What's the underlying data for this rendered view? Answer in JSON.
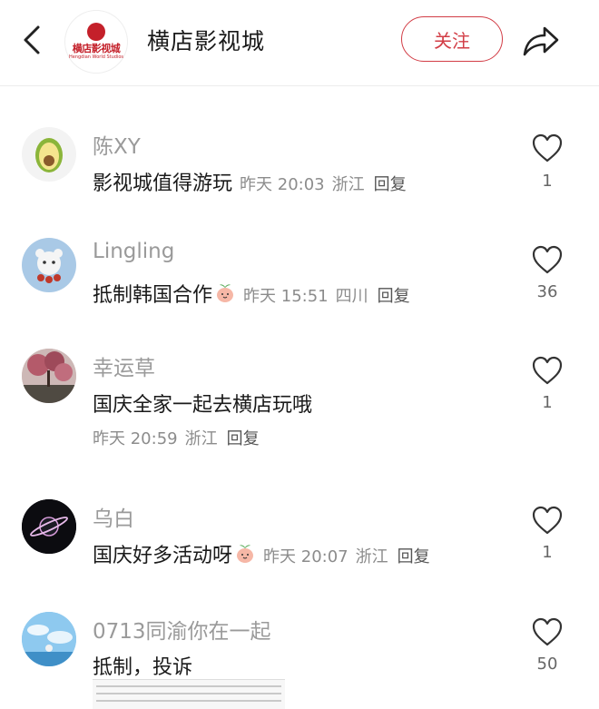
{
  "header": {
    "title": "横店影视城",
    "logo_text": "横店影视城",
    "logo_sub": "Hengdian World Studios",
    "follow_label": "关注",
    "back_icon": "chevron-left-icon",
    "share_icon": "share-icon"
  },
  "comments": [
    {
      "name": "陈XY",
      "text": "影视城值得游玩",
      "time": "昨天 20:03",
      "location": "浙江",
      "reply": "回复",
      "likes": "1",
      "avatar": "avocado-avatar"
    },
    {
      "name": "Lingling",
      "text": "抵制韩国合作",
      "time": "昨天 15:51",
      "location": "四川",
      "reply": "回复",
      "likes": "36",
      "avatar": "cartoon-bear-avatar"
    },
    {
      "name": "幸运草",
      "text": "国庆全家一起去横店玩哦",
      "time": "昨天 20:59",
      "location": "浙江",
      "reply": "回复",
      "likes": "1",
      "avatar": "blossom-tree-avatar"
    },
    {
      "name": "乌白",
      "text": "国庆好多活动呀",
      "time": "昨天 20:07",
      "location": "浙江",
      "reply": "回复",
      "likes": "1",
      "avatar": "dark-planet-avatar"
    },
    {
      "name": "0713同渝你在一起",
      "text": "抵制，投诉",
      "likes": "50",
      "avatar": "anime-sky-avatar"
    }
  ],
  "colors": {
    "accent": "#d23d46",
    "meta": "#8c8c8c",
    "name": "#9a9a9a"
  }
}
